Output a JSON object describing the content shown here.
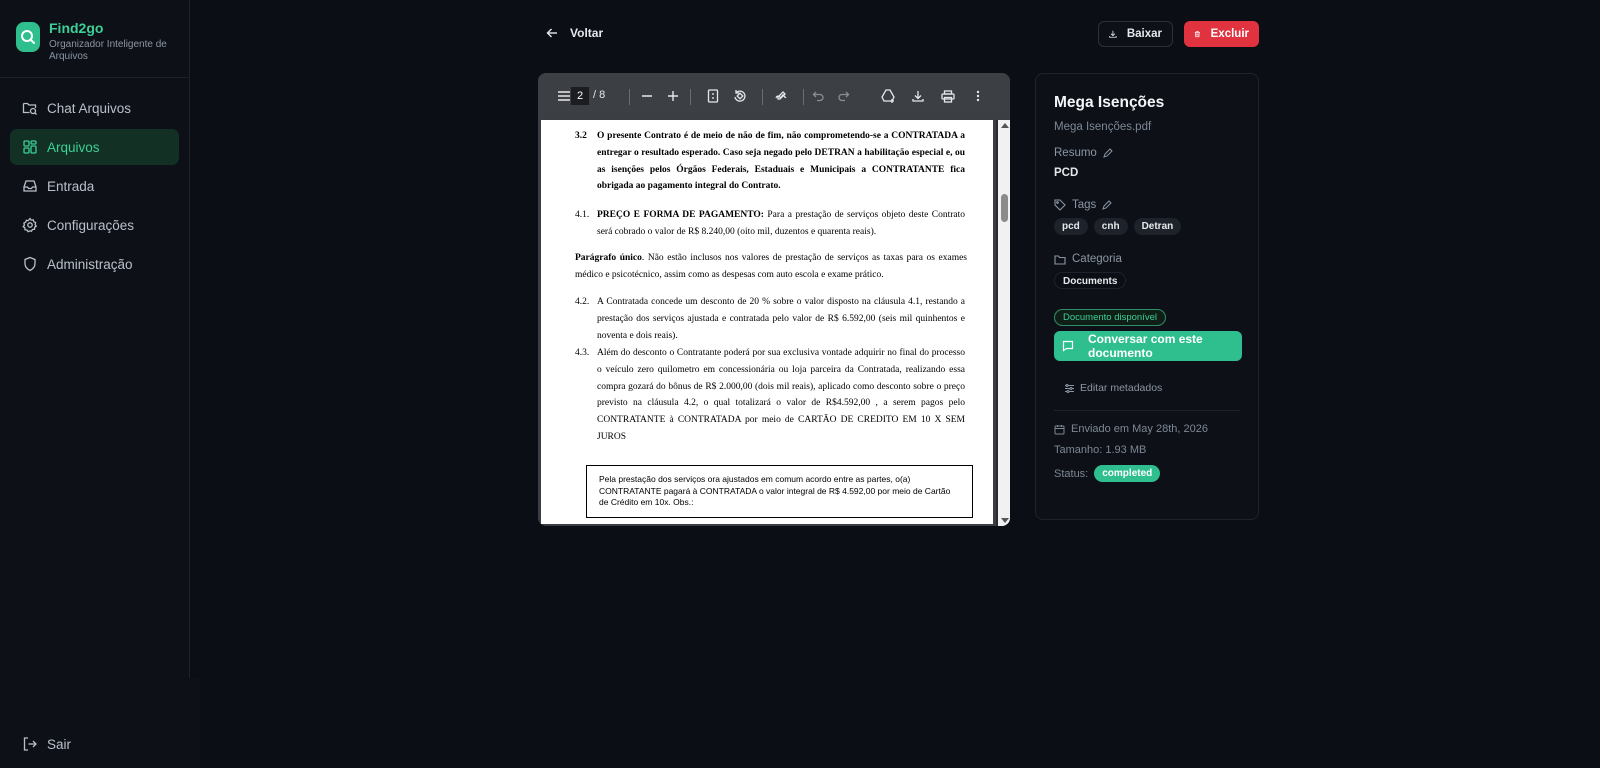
{
  "app": {
    "name": "Find2go",
    "subtitle": "Organizador Inteligente de Arquivos"
  },
  "sidebar": {
    "items": [
      {
        "label": "Chat Arquivos",
        "icon": "folder-search-icon"
      },
      {
        "label": "Arquivos",
        "icon": "grid-icon",
        "active": true
      },
      {
        "label": "Entrada",
        "icon": "inbox-icon"
      },
      {
        "label": "Configurações",
        "icon": "gear-icon"
      },
      {
        "label": "Administração",
        "icon": "shield-icon"
      }
    ],
    "logout_label": "Sair"
  },
  "actions": {
    "back_label": "Voltar",
    "download_label": "Baixar",
    "delete_label": "Excluir"
  },
  "viewer": {
    "current_page": "2",
    "total_pages": "/ 8",
    "content": {
      "c32_num": "3.2",
      "c32_text": "O presente Contrato é de meio de não de fim, não comprometendo-se a CONTRATADA a entregar o resultado esperado. Caso seja negado pelo DETRAN a habilitação especial e, ou as isenções pelos Órgãos Federais, Estaduais e Municipais a CONTRATANTE fica obrigada ao pagamento integral do Contrato.",
      "c41_num": "4.1.",
      "c41_title": "PREÇO E FORMA DE PAGAMENTO:",
      "c41_text": " Para a prestação de serviços objeto deste Contrato será cobrado o valor de R$ 8.240,00 (oito mil, duzentos e quarenta reais).",
      "pu_title": "Parágrafo único",
      "pu_text": ". Não estão inclusos nos valores de prestação de serviços as taxas para os exames médico e psicotécnico, assim como as despesas com auto escola e exame prático.",
      "c42_num": "4.2.",
      "c42_text": "A Contratada concede um desconto de 20 % sobre o valor disposto na cláusula 4.1, restando a prestação dos serviços ajustada e contratada pelo valor de R$ 6.592,00 (seis mil quinhentos e noventa e dois reais).",
      "c43_num": "4.3.",
      "c43_text": "Além do desconto o Contratante poderá por sua exclusiva vontade adquirir no final do processo o veículo zero quilometro em concessionária ou loja parceira da Contratada, realizando essa compra gozará do bônus de R$ 2.000,00 (dois mil reais), aplicado como desconto sobre o preço previsto na cláusula 4.2, o qual totalizará o valor de R$4.592,00 , a serem pagos pelo  CONTRATANTE à CONTRATADA por meio de  CARTÃO DE CREDITO EM 10 X SEM JUROS",
      "box_text": "Pela prestação dos serviços ora ajustados em comum acordo entre as partes, o(a) CONTRATANTE pagará à CONTRATADA o valor integral de R$ 4.592,00 por meio de Cartão de Crédito em 10x. Obs.:"
    }
  },
  "details": {
    "title": "Mega Isenções",
    "filename": "Mega Isenções.pdf",
    "summary_label": "Resumo",
    "summary_value": "PCD",
    "tags_label": "Tags",
    "tags": [
      "pcd",
      "cnh",
      "Detran"
    ],
    "category_label": "Categoria",
    "category_value": "Documents",
    "availability": "Documento disponível",
    "chat_button": "Conversar com este documento",
    "edit_metadata": "Editar metadados",
    "sent": "Enviado em May 28th, 2026",
    "size": "Tamanho: 1.93 MB",
    "status_label": "Status:",
    "status_value": "completed"
  },
  "colors": {
    "accent": "#2fbf8f",
    "danger": "#e0323f",
    "background": "#0b0e14"
  }
}
